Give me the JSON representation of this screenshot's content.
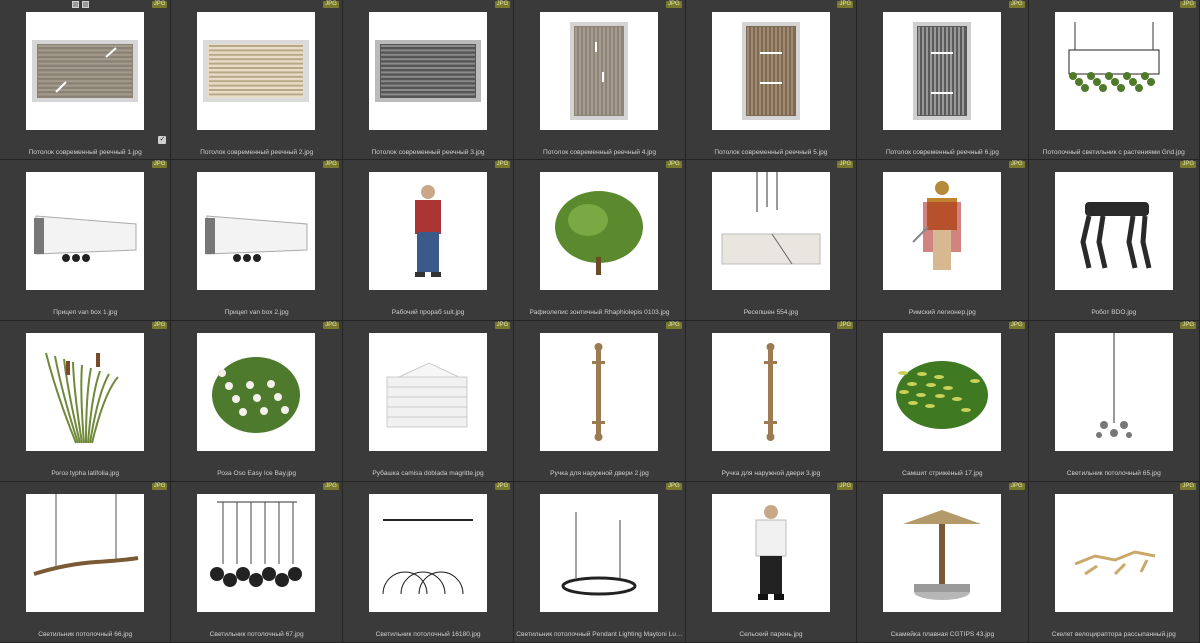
{
  "badge_label": "JPG",
  "items": [
    {
      "caption": "Потолок современный реечный 1.jpg",
      "icon": "slatted-ceiling-diagonal"
    },
    {
      "caption": "Потолок современный реечный 2.jpg",
      "icon": "slatted-ceiling-light"
    },
    {
      "caption": "Потолок современный реечный 3.jpg",
      "icon": "slatted-ceiling-dark"
    },
    {
      "caption": "Потолок современный реечный 4.jpg",
      "icon": "slatted-ceiling-vertical"
    },
    {
      "caption": "Потолок современный реечный 5.jpg",
      "icon": "slatted-ceiling-wood"
    },
    {
      "caption": "Потолок современный реечный 6.jpg",
      "icon": "slatted-ceiling-grey"
    },
    {
      "caption": "Потолочный светильник с растениями Grid.jpg",
      "icon": "grid-plant-lamp"
    },
    {
      "caption": "Прицеп van box 1.jpg",
      "icon": "trailer"
    },
    {
      "caption": "Прицеп van box 2.jpg",
      "icon": "trailer"
    },
    {
      "caption": "Рабочий прораб suit.jpg",
      "icon": "worker"
    },
    {
      "caption": "Рафиолепис зонтичный Rhaphiolepis 0103.jpg",
      "icon": "shrub"
    },
    {
      "caption": "Ресепшен 554.jpg",
      "icon": "reception-desk"
    },
    {
      "caption": "Римский легионер.jpg",
      "icon": "legionnaire"
    },
    {
      "caption": "Робот BDO.jpg",
      "icon": "robot-dog"
    },
    {
      "caption": "Рогоз typha latifolia.jpg",
      "icon": "cattail"
    },
    {
      "caption": "Роза Oso Easy Ice Bay.jpg",
      "icon": "rose-bush"
    },
    {
      "caption": "Рубашка camisa doblada magritte.jpg",
      "icon": "folded-shirts"
    },
    {
      "caption": "Ручка для наружной двери 2.jpg",
      "icon": "door-handle"
    },
    {
      "caption": "Ручка для наружной двери 3.jpg",
      "icon": "door-handle"
    },
    {
      "caption": "Самшит стриженый 17.jpg",
      "icon": "boxwood"
    },
    {
      "caption": "Светильник потолочный 65.jpg",
      "icon": "chandelier-molecule"
    },
    {
      "caption": "Светильник потолочный 66.jpg",
      "icon": "branch-lamp"
    },
    {
      "caption": "Светильник потолочный 67.jpg",
      "icon": "ring-lamp-cluster"
    },
    {
      "caption": "Светильник потолочный 16180.jpg",
      "icon": "arc-lamp"
    },
    {
      "caption": "Светильник потолочный Pendant Lighting Maytoni Luce Rid...",
      "icon": "ring-pendant"
    },
    {
      "caption": "Сельский парень.jpg",
      "icon": "villager"
    },
    {
      "caption": "Скамейка плавная CGTIPS 43.jpg",
      "icon": "parasol-bench"
    },
    {
      "caption": "Скелет велоцираптора рассыпанный.jpg",
      "icon": "skeleton"
    }
  ]
}
